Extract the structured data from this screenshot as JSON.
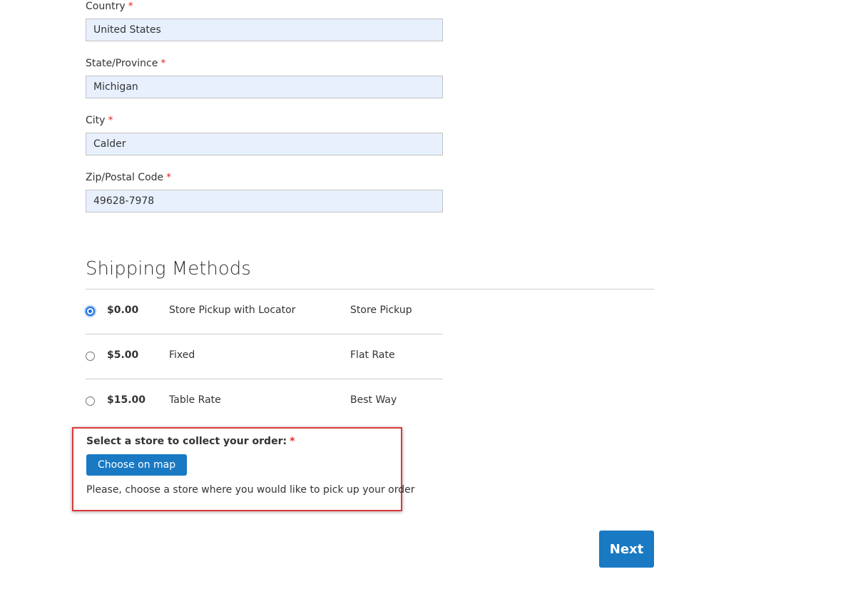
{
  "address": {
    "country": {
      "label": "Country",
      "required": "*",
      "value": "United States"
    },
    "state": {
      "label": "State/Province",
      "required": "*",
      "value": "Michigan"
    },
    "city": {
      "label": "City",
      "required": "*",
      "value": "Calder"
    },
    "zip": {
      "label": "Zip/Postal Code",
      "required": "*",
      "value": "49628-7978"
    }
  },
  "shipping": {
    "title": "Shipping Methods",
    "methods": [
      {
        "price": "$0.00",
        "name": "Store Pickup with Locator",
        "carrier": "Store Pickup",
        "selected": true
      },
      {
        "price": "$5.00",
        "name": "Fixed",
        "carrier": "Flat Rate",
        "selected": false
      },
      {
        "price": "$15.00",
        "name": "Table Rate",
        "carrier": "Best Way",
        "selected": false
      }
    ]
  },
  "store_pickup": {
    "label": "Select a store to collect your order:",
    "required": "*",
    "button_label": "Choose on map",
    "hint": "Please, choose a store where you would like to pick up your order",
    "highlight_color": "#d93a3a"
  },
  "actions": {
    "next_label": "Next"
  },
  "colors": {
    "primary_button": "#1979c3",
    "required_star": "#e02b27",
    "input_fill": "#e8f0fe"
  }
}
